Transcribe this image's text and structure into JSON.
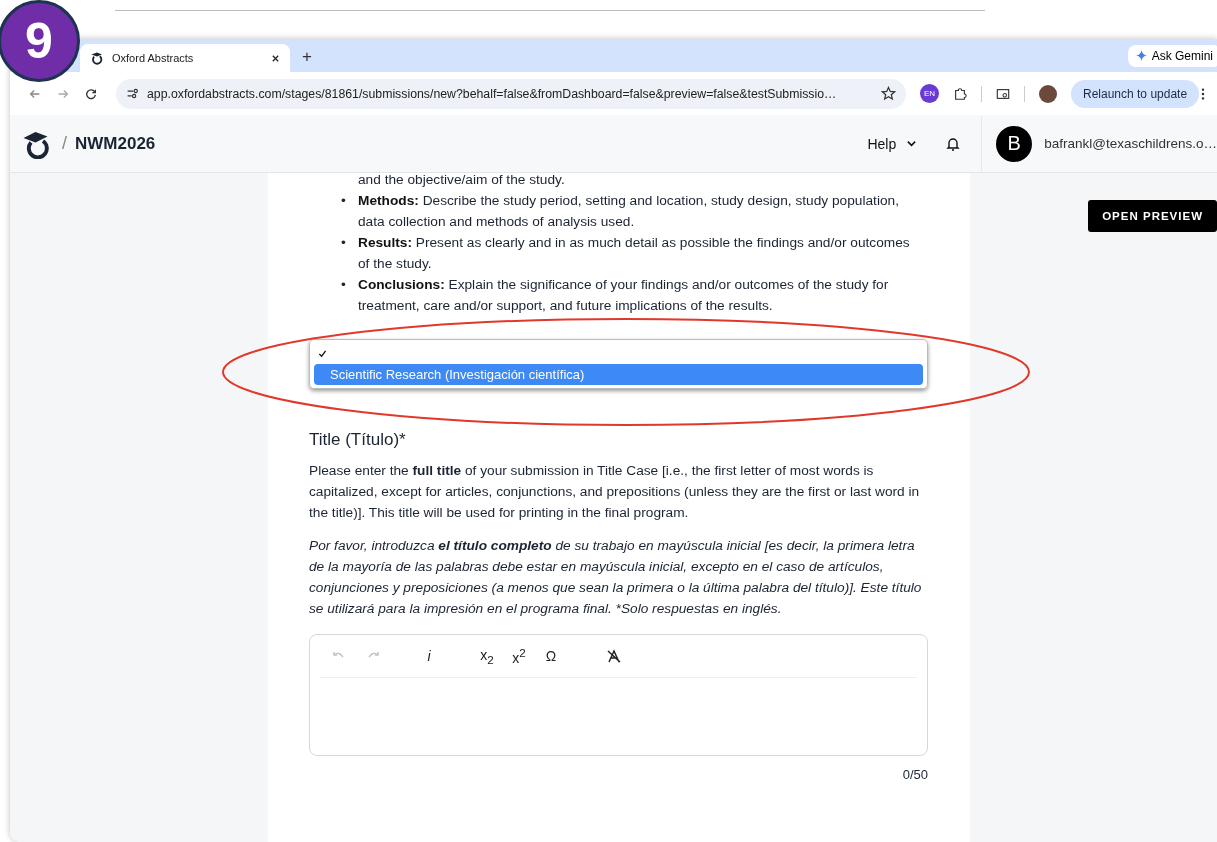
{
  "step_badge": "9",
  "browser": {
    "tabs": [
      {
        "title": "Oxford Abstracts",
        "selected": true
      }
    ],
    "new_tab": "+",
    "ask_button": "Ask Gemini",
    "url": "app.oxfordabstracts.com/stages/81861/submissions/new?behalf=false&fromDashboard=false&preview=false&testSubmissio…",
    "extension_badge": "EN",
    "relaunch_button": "Relaunch to update"
  },
  "app_header": {
    "separator": "/",
    "event": "NWM2026",
    "help": "Help",
    "avatar_letter": "B",
    "user": "bafrankl@texaschildrens.o…"
  },
  "open_preview": "OPEN PREVIEW",
  "intro_fragment": "and the objective/aim of the study.",
  "guidelines": [
    {
      "bullet": "•",
      "text": "**Methods:** Describe the study period, setting and location, study design, study population, data collection and methods of analysis used."
    },
    {
      "bullet": "•",
      "text": "**Results:** Present as clearly and in as much detail as possible the findings and/or outcomes of the study."
    },
    {
      "bullet": "•",
      "text": "**Conclusions:** Explain the significance of your findings and/or outcomes of the study for treatment, care and/or support, and future implications of the results."
    }
  ],
  "dropdown": {
    "options": [
      {
        "checked": true,
        "highlighted": false
      },
      {
        "label": "Scientific Research (Investigación científica)",
        "checked": false,
        "highlighted": true
      }
    ]
  },
  "title_field": {
    "label": "Title (Título)*",
    "help_en": "Please enter the **full title** of your submission in Title Case [i.e., the first letter of most words is capitalized, except for articles, conjunctions, and prepositions (unless they are the first or last word in the title)]. This title will be used for printing in the final program.",
    "help_es": "Por favor, introduzca **el título completo** de su trabajo en mayúscula inicial [es decir, la primera letra de la mayoría de las palabras debe estar en mayúscula inicial, excepto en el caso de artículos, conjunciones y preposiciones (a menos que sean la primera o la última palabra del título)]. Este título se utilizará para la impresión en el programa final. *Solo respuestas en inglés.",
    "toolbar": [
      {
        "kind": "undo",
        "disabled": true
      },
      {
        "kind": "redo",
        "disabled": true
      },
      {
        "kind": "italic",
        "label": "i",
        "disabled": false
      },
      {
        "kind": "text",
        "label": "x$_{2}$",
        "disabled": false
      },
      {
        "kind": "text",
        "label": "x$^{2}$",
        "disabled": false
      },
      {
        "kind": "text",
        "label": "Ω",
        "disabled": false
      },
      {
        "kind": "clear",
        "disabled": false
      }
    ],
    "counter": "0/50"
  }
}
